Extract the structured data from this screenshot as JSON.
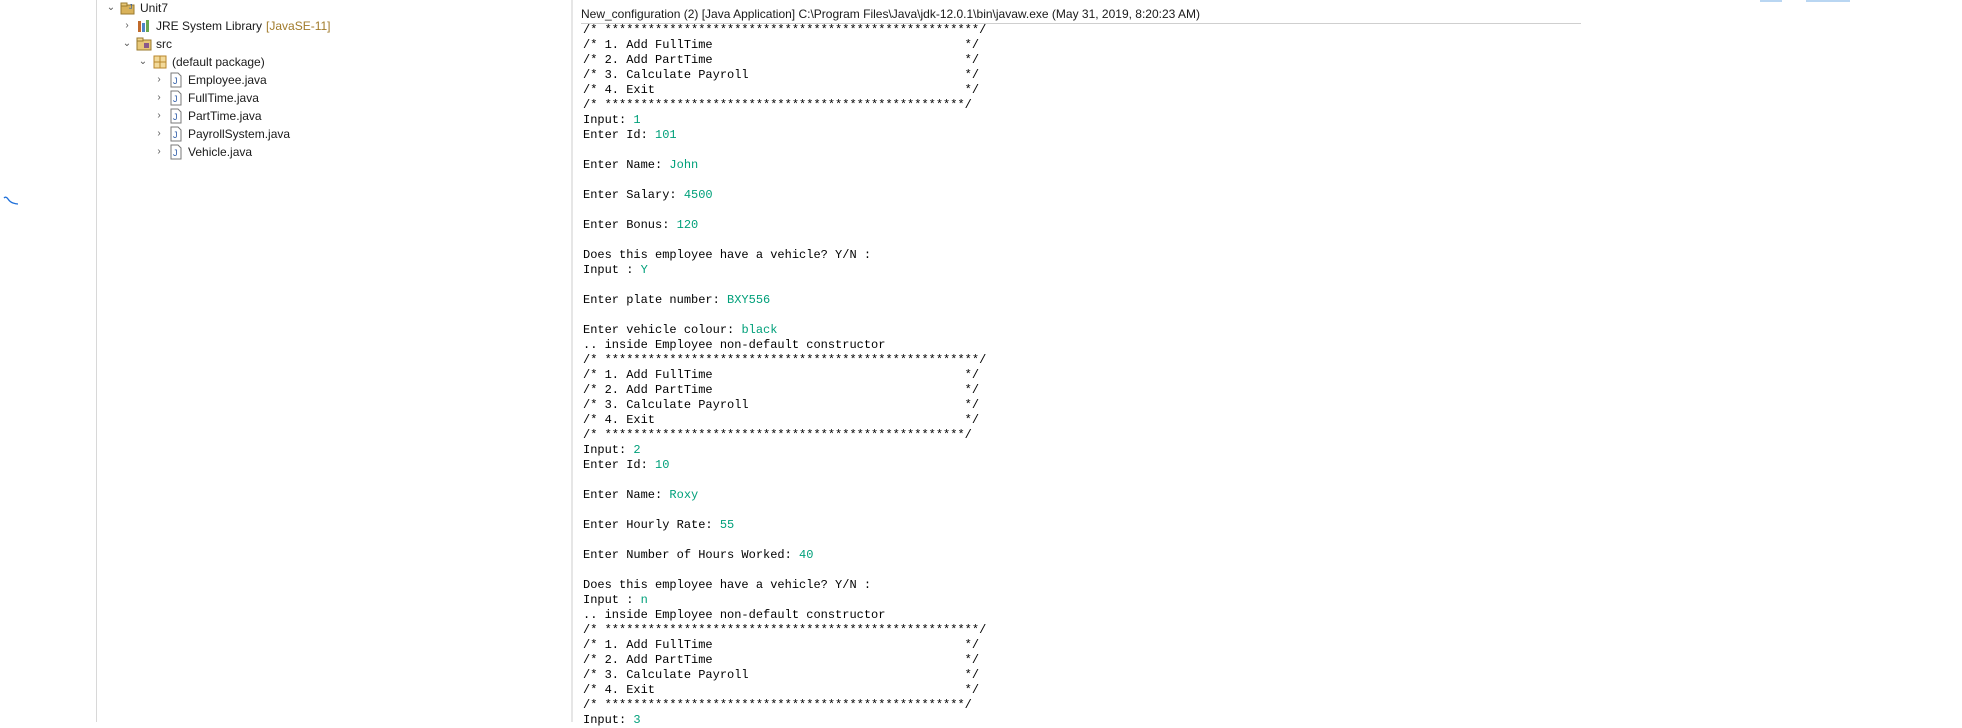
{
  "explorer": {
    "project": "Unit7",
    "jre_library": "JRE System Library",
    "jre_version": "[JavaSE-11]",
    "src_folder": "src",
    "package": "(default package)",
    "files": [
      "Employee.java",
      "FullTime.java",
      "PartTime.java",
      "PayrollSystem.java",
      "Vehicle.java"
    ]
  },
  "console": {
    "header": "New_configuration (2) [Java Application] C:\\Program Files\\Java\\jdk-12.0.1\\bin\\javaw.exe (May 31, 2019, 8:20:23 AM)",
    "lines": [
      {
        "text": "/* ****************************************************/",
        "input": ""
      },
      {
        "text": "/* 1. Add FullTime                                   */",
        "input": ""
      },
      {
        "text": "/* 2. Add PartTime                                   */",
        "input": ""
      },
      {
        "text": "/* 3. Calculate Payroll                              */",
        "input": ""
      },
      {
        "text": "/* 4. Exit                                           */",
        "input": ""
      },
      {
        "text": "/* **************************************************/",
        "input": ""
      },
      {
        "text": "Input: ",
        "input": "1"
      },
      {
        "text": "Enter Id: ",
        "input": "101"
      },
      {
        "text": "",
        "input": ""
      },
      {
        "text": "Enter Name: ",
        "input": "John"
      },
      {
        "text": "",
        "input": ""
      },
      {
        "text": "Enter Salary: ",
        "input": "4500"
      },
      {
        "text": "",
        "input": ""
      },
      {
        "text": "Enter Bonus: ",
        "input": "120"
      },
      {
        "text": "",
        "input": ""
      },
      {
        "text": "Does this employee have a vehicle? Y/N :",
        "input": ""
      },
      {
        "text": "Input : ",
        "input": "Y"
      },
      {
        "text": "",
        "input": ""
      },
      {
        "text": "Enter plate number: ",
        "input": "BXY556"
      },
      {
        "text": "",
        "input": ""
      },
      {
        "text": "Enter vehicle colour: ",
        "input": "black"
      },
      {
        "text": ".. inside Employee non-default constructor",
        "input": ""
      },
      {
        "text": "/* ****************************************************/",
        "input": ""
      },
      {
        "text": "/* 1. Add FullTime                                   */",
        "input": ""
      },
      {
        "text": "/* 2. Add PartTime                                   */",
        "input": ""
      },
      {
        "text": "/* 3. Calculate Payroll                              */",
        "input": ""
      },
      {
        "text": "/* 4. Exit                                           */",
        "input": ""
      },
      {
        "text": "/* **************************************************/",
        "input": ""
      },
      {
        "text": "Input: ",
        "input": "2"
      },
      {
        "text": "Enter Id: ",
        "input": "10"
      },
      {
        "text": "",
        "input": ""
      },
      {
        "text": "Enter Name: ",
        "input": "Roxy"
      },
      {
        "text": "",
        "input": ""
      },
      {
        "text": "Enter Hourly Rate: ",
        "input": "55"
      },
      {
        "text": "",
        "input": ""
      },
      {
        "text": "Enter Number of Hours Worked: ",
        "input": "40"
      },
      {
        "text": "",
        "input": ""
      },
      {
        "text": "Does this employee have a vehicle? Y/N :",
        "input": ""
      },
      {
        "text": "Input : ",
        "input": "n"
      },
      {
        "text": ".. inside Employee non-default constructor",
        "input": ""
      },
      {
        "text": "/* ****************************************************/",
        "input": ""
      },
      {
        "text": "/* 1. Add FullTime                                   */",
        "input": ""
      },
      {
        "text": "/* 2. Add PartTime                                   */",
        "input": ""
      },
      {
        "text": "/* 3. Calculate Payroll                              */",
        "input": ""
      },
      {
        "text": "/* 4. Exit                                           */",
        "input": ""
      },
      {
        "text": "/* **************************************************/",
        "input": ""
      },
      {
        "text": "Input: ",
        "input": "3"
      }
    ]
  },
  "colors": {
    "input_text": "#00a07a",
    "decoration": "#a07a2a",
    "squiggle": "#1e6fd9"
  }
}
